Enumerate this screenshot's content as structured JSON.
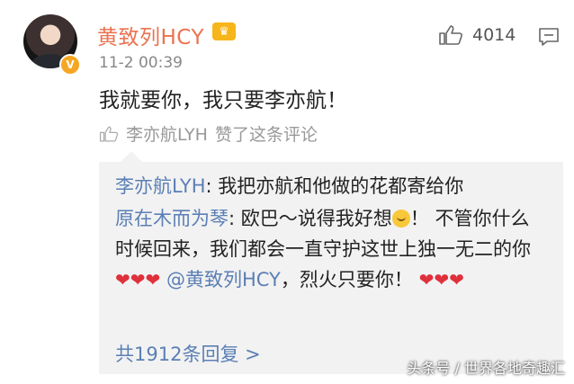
{
  "comment": {
    "username": "黄致列HCY",
    "crown_icon": "crown-icon",
    "verified_icon": "verified-badge-icon",
    "verified_text": "V",
    "timestamp": "11-2 00:39",
    "like_count": "4014",
    "text": "我就要你，我只要李亦航！",
    "liked_by": "李亦航LYH",
    "liked_suffix": "赞了这条评论"
  },
  "replies": [
    {
      "author": "李亦航LYH",
      "separator": ": ",
      "text": "我把亦航和他做的花都寄给你"
    },
    {
      "author": "原在木而为琴",
      "separator": ": ",
      "text_a": "欧巴～说得我好想",
      "text_b": "！ 不管你什么时候回来，我们都会一直守护这世上独一无二的你",
      "hearts": "❤❤❤",
      "mention": "@黄致列HCY",
      "text_c": "，烈火只要你！",
      "hearts_end": "❤❤❤"
    }
  ],
  "more_replies": "共1912条回复 >",
  "watermark": "头条号 / 世界各地奇趣汇",
  "colors": {
    "username": "#eb7350",
    "link": "#5b7fb5",
    "heart": "#e0303c",
    "reply_bg": "#f2f2f2"
  }
}
